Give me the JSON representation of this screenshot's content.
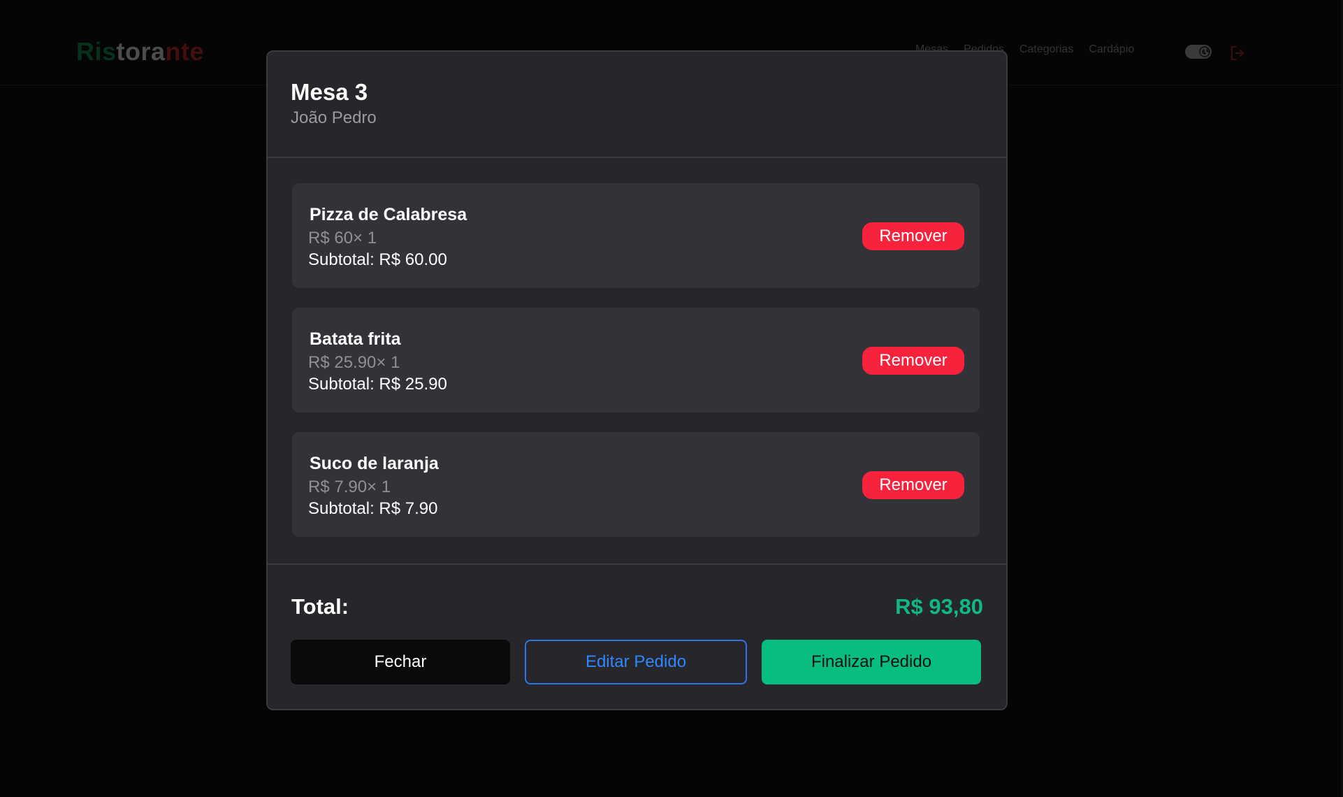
{
  "header": {
    "logo": {
      "part1": "Ris",
      "part2": "tora",
      "part3": "nte"
    },
    "nav": [
      {
        "label": "Mesas"
      },
      {
        "label": "Pedidos"
      },
      {
        "label": "Categorias"
      },
      {
        "label": "Cardápio"
      }
    ],
    "theme_toggle_icon": "moon-icon",
    "logout_icon": "logout-icon"
  },
  "modal": {
    "title": "Mesa 3",
    "subtitle": "João Pedro",
    "items": [
      {
        "name": "Pizza de Calabresa",
        "price_line": "R$ 60× 1",
        "subtotal_line": "Subtotal: R$ 60.00",
        "remove_label": "Remover"
      },
      {
        "name": "Batata frita",
        "price_line": "R$ 25.90× 1",
        "subtotal_line": "Subtotal: R$ 25.90",
        "remove_label": "Remover"
      },
      {
        "name": "Suco de laranja",
        "price_line": "R$ 7.90× 1",
        "subtotal_line": "Subtotal: R$ 7.90",
        "remove_label": "Remover"
      }
    ],
    "total_label": "Total:",
    "total_value": "R$ 93,80",
    "actions": {
      "close_label": "Fechar",
      "edit_label": "Editar Pedido",
      "finish_label": "Finalizar Pedido"
    }
  },
  "colors": {
    "logo_green": "#0b5a34",
    "logo_gray": "#8a8a8a",
    "logo_red": "#7a1a1a",
    "remove_red": "#f7233d",
    "total_green": "#10b981",
    "finish_green": "#07bd7f",
    "edit_blue": "#2f86ff"
  }
}
